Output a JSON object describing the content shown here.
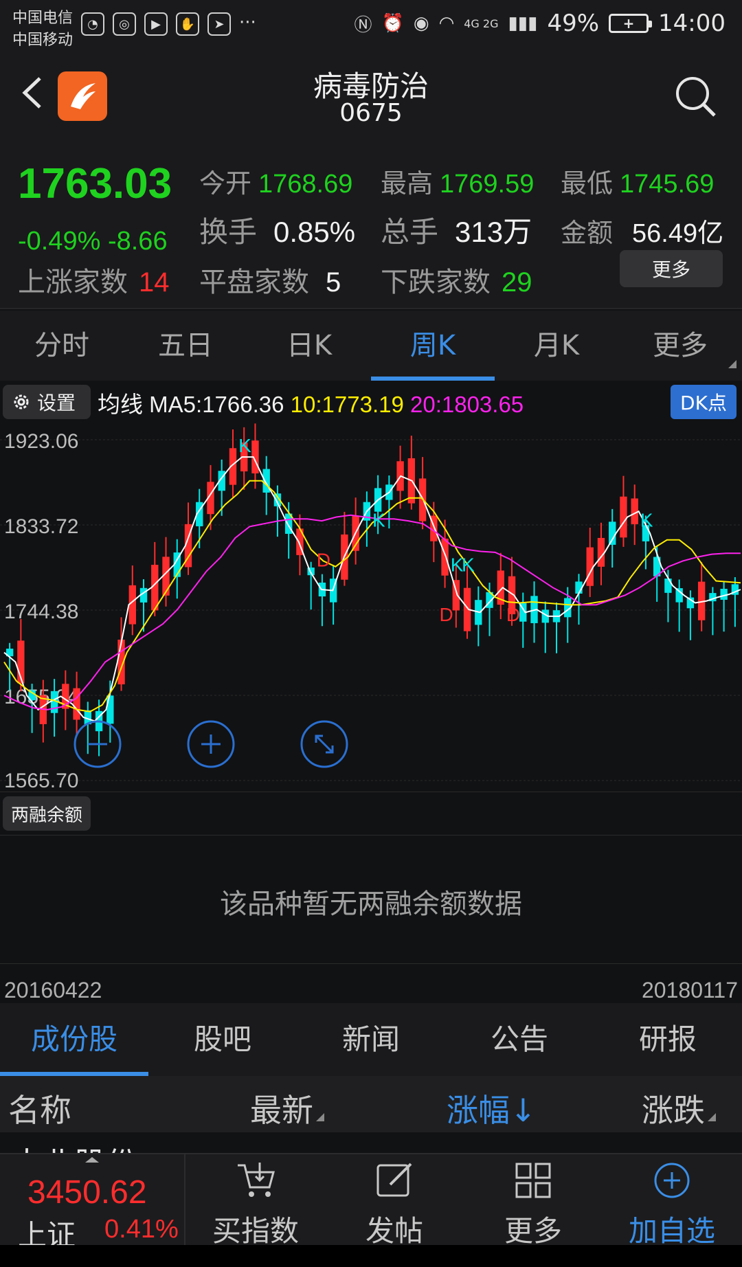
{
  "status_bar": {
    "carrier1": "中国电信",
    "carrier2": "中国移动",
    "more_dots": "···",
    "network": "4G 2G",
    "battery": "49%",
    "time": "14:00"
  },
  "header": {
    "title": "病毒防治",
    "code": "0675"
  },
  "quote": {
    "price": "1763.03",
    "change": "-0.49% -8.66",
    "open_label": "今开",
    "open": "1768.69",
    "high_label": "最高",
    "high": "1769.59",
    "low_label": "最低",
    "low": "1745.69",
    "turnover_label": "换手",
    "turnover": "0.85%",
    "volume_label": "总手",
    "volume": "313万",
    "amount_label": "金额",
    "amount": "56.49亿",
    "up_label": "上涨家数",
    "up_count": "14",
    "flat_label": "平盘家数",
    "flat_count": "5",
    "down_label": "下跌家数",
    "down_count": "29",
    "more": "更多"
  },
  "period_tabs": [
    "分时",
    "五日",
    "日K",
    "周K",
    "月K",
    "更多"
  ],
  "ma_bar": {
    "settings": "设置",
    "ma5": "均线 MA5:1766.36",
    "ma10": "10:1773.19",
    "ma20": "20:1803.65",
    "dk": "DK点"
  },
  "colors": {
    "up": "#ff2d2d",
    "down": "#00e5e5",
    "price_green": "#1fd21f",
    "ma5": "#ffffff",
    "ma10": "#ffee00",
    "ma20": "#ff22ee",
    "accent": "#3a8ee6"
  },
  "chart_data": {
    "type": "candlestick",
    "y_tick_labels": [
      "1923.06",
      "1833.72",
      "1744.38",
      "1655.04",
      "1565.70"
    ],
    "ylim": [
      1565.7,
      1923.06
    ],
    "marker_labels": [
      "K",
      "K",
      "K",
      "K",
      "K",
      "D",
      "D",
      "D"
    ],
    "series": [
      {
        "name": "MA5",
        "values": [
          1700,
          1690,
          1655,
          1640,
          1648,
          1654,
          1646,
          1632,
          1628,
          1640,
          1690,
          1750,
          1760,
          1768,
          1780,
          1792,
          1812,
          1845,
          1862,
          1880,
          1895,
          1905,
          1905,
          1880,
          1860,
          1835,
          1816,
          1785,
          1766,
          1765,
          1800,
          1825,
          1848,
          1860,
          1868,
          1885,
          1880,
          1860,
          1830,
          1800,
          1760,
          1745,
          1742,
          1755,
          1768,
          1760,
          1742,
          1745,
          1738,
          1738,
          1747,
          1768,
          1790,
          1805,
          1825,
          1842,
          1848,
          1825,
          1790,
          1770,
          1760,
          1752,
          1754,
          1758,
          1761,
          1766
        ]
      },
      {
        "name": "MA10",
        "values": [
          1690,
          1670,
          1660,
          1652,
          1650,
          1645,
          1640,
          1638,
          1645,
          1665,
          1700,
          1720,
          1740,
          1760,
          1780,
          1800,
          1820,
          1840,
          1855,
          1866,
          1880,
          1880,
          1868,
          1850,
          1832,
          1808,
          1796,
          1790,
          1800,
          1820,
          1836,
          1845,
          1856,
          1862,
          1862,
          1848,
          1828,
          1805,
          1788,
          1770,
          1758,
          1753,
          1752,
          1753,
          1752,
          1751,
          1750,
          1750,
          1752,
          1754,
          1758,
          1778,
          1795,
          1810,
          1818,
          1818,
          1808,
          1790,
          1775,
          1774,
          1773
        ]
      },
      {
        "name": "MA20",
        "values": [
          1655,
          1648,
          1642,
          1640,
          1643,
          1652,
          1670,
          1690,
          1700,
          1710,
          1720,
          1730,
          1745,
          1765,
          1785,
          1800,
          1820,
          1832,
          1835,
          1838,
          1840,
          1840,
          1838,
          1842,
          1844,
          1842,
          1840,
          1840,
          1838,
          1835,
          1825,
          1812,
          1808,
          1806,
          1805,
          1798,
          1788,
          1778,
          1768,
          1760,
          1750,
          1750,
          1755,
          1760,
          1768,
          1778,
          1790,
          1796,
          1800,
          1803,
          1804,
          1804
        ]
      }
    ],
    "ohlc_note": "weekly candles 20160422–20180117"
  },
  "chart_controls": {
    "zoom_out": "−",
    "zoom_in": "+",
    "fullscreen": "⤢"
  },
  "margin": {
    "tag": "两融余额",
    "empty_text": "该品种暂无两融余额数据"
  },
  "dates": {
    "start": "20160422",
    "end": "20180117"
  },
  "info_tabs": [
    "成份股",
    "股吧",
    "新闻",
    "公告",
    "研报"
  ],
  "list_header": {
    "name": "名称",
    "latest": "最新",
    "change_pct": "涨幅↓",
    "change": "涨跌"
  },
  "partial_row": {
    "name": "大北股份"
  },
  "bottom_bar": {
    "index_price": "3450.62",
    "index_name": "上证",
    "index_pct": "0.41%",
    "buy_index": "买指数",
    "post": "发帖",
    "more": "更多",
    "add_watch": "加自选"
  }
}
